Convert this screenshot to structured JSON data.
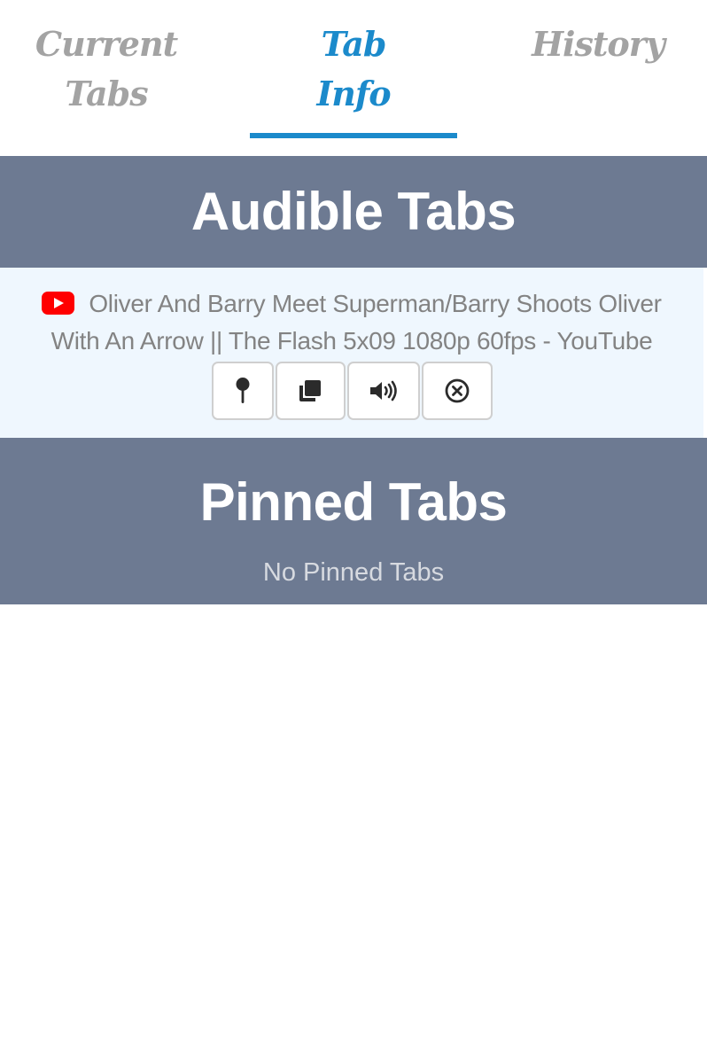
{
  "tabs": [
    {
      "lines": [
        "Current",
        "Tabs"
      ],
      "active": false
    },
    {
      "lines": [
        "Tab",
        "Info"
      ],
      "active": true
    },
    {
      "lines": [
        "History"
      ],
      "active": false
    }
  ],
  "audible": {
    "title": "Audible Tabs",
    "items": [
      {
        "favicon": "youtube-icon",
        "title": "Oliver And Barry Meet Superman/Barry Shoots Oliver With An Arrow || The Flash 5x09 1080p 60fps - YouTube",
        "actions": [
          "pin-icon",
          "duplicate-icon",
          "volume-icon",
          "close-circle-icon"
        ]
      }
    ]
  },
  "pinned": {
    "title": "Pinned Tabs",
    "empty_text": "No Pinned Tabs"
  },
  "colors": {
    "accent": "#1b8acb",
    "section_bg": "#6d7a92",
    "item_bg": "#eff7fe",
    "youtube_red": "#ff0000"
  }
}
